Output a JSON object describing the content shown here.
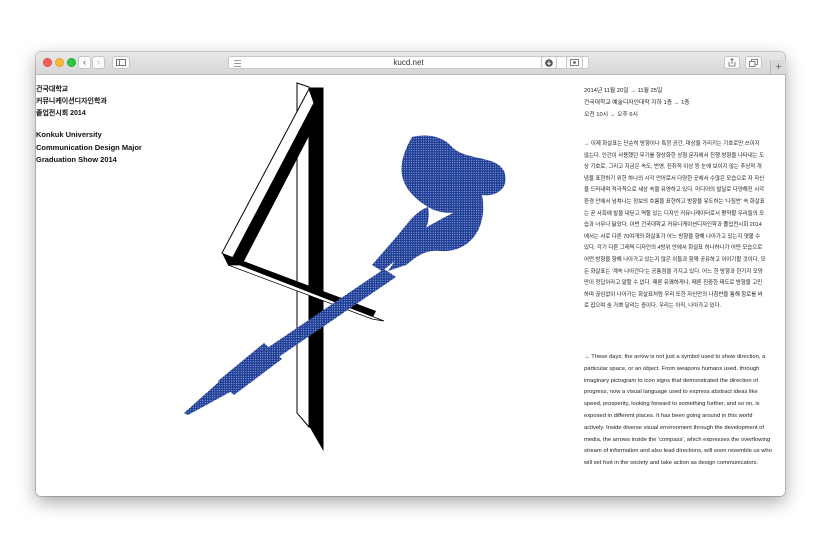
{
  "browser": {
    "url": "kucd.net",
    "back_symbol": "‹",
    "forward_symbol": "›",
    "new_tab_symbol": "+"
  },
  "page": {
    "title_kr": [
      "건국대학교",
      "커뮤니케이션디자인학과",
      "졸업전시회 2014"
    ],
    "title_en": [
      "Konkuk University",
      "Communication Design Major",
      "Graduation Show 2014"
    ],
    "info": [
      "2014년 11월 20일 → 11월 25일",
      "건국대학교 예술디자인대학 지하 1층 → 1층",
      "오전 10시 → 오후 6시"
    ],
    "body_kr": "→ 이제 화살표는 단순히 방향이나 특정 공간, 대상을 가리키는 기호로만 쓰이지 않는다. 인간이 사용했던 무기를 형상화한 상형 문자에서 진행 방향을 나타내는 도상 기호로, 그리고 지금은 속도, 번영, 진취적 이상 등 눈에 보이지 않는 추상적 개념을 표현하기 위한 하나의 시각 언어로서 다양한 곳에서 수많은 모습으로 자 자신을 드러내며 적극적으로 세상 속을 유영하고 있다. 미디어의 발달로 다양해진 시각 환경 안에서 넘쳐나는 정보의 흐름을 표현하고 방향을 유도하는 '나침반' 속 화살표는 곧 사회에 발을 내딛고 역할 있는 디자인 커뮤니케이터로서 활약할 우리들의 모습과 너무나 닮았다. 이번 건국대학교 커뮤니케이션디자인학과 졸업전시회 2014에서는 서로 다른 70여개의 화살표가 어느 방향을 향해 나아가고 있는지 엿볼 수 있다. 각기 다른 그래픽 디자인의 4방위 안에서 화살표 하나하나가 어떤 모습으로 어떤 방향을 향해 나아가고 있는지 많은 이들과 함께 공유하고 이야기할 것이다. 모든 화살표는 '계속 나아간다'는 공통점을 가지고 있다. 어느 한 방향과 한가지 모양만이 정답이라고 말할 수 없다. 때론 유쾌하게나, 때론 진중한 태도로 방향을 고민하며 끊임없이 나아가는 화살표처럼 우리 또한 자신만의 나침반을 통해 항로를 바로 잡으며 숨 가쁘 달리는 중이다. 우리는 아직, 나아가고 있다.",
    "body_en": "→ These days, the arrow is not just a symbol used to show direction, a particular space, or an object. From weapons humans used, through imaginary pictogram to icon signs that demonstrated the direction of progress, now a visual language used to express abstract ideas like speed, prosperity, looking forward to something further, and so on, is exposed in different places. It has been going around in this world actively. Inside diverse visual environment through the development of media, the arrows  inside the 'compass', which expresses the overflowing stream of information and also lead directions, will soon resemble us who will set foot in the society and take action as design communicators."
  },
  "colors": {
    "dart_blue": "#1b3c97",
    "four_black": "#000000",
    "light_red": "#fc5f57",
    "light_yellow": "#fdbc2e",
    "light_green": "#2ac940"
  }
}
